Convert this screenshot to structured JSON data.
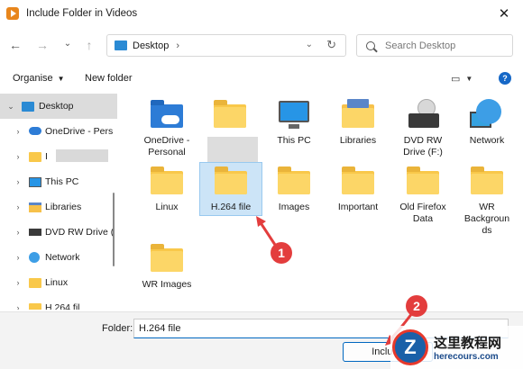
{
  "window": {
    "title": "Include Folder in Videos",
    "close_glyph": "✕"
  },
  "nav": {
    "back": "←",
    "forward": "→",
    "recent": "⌄",
    "up": "↑"
  },
  "address": {
    "location": "Desktop",
    "separator": "›",
    "dropdown": "⌄",
    "refresh": "↻"
  },
  "search": {
    "placeholder": "Search Desktop"
  },
  "toolbar": {
    "organise_label": "Organise",
    "organise_caret": "▼",
    "new_folder_label": "New folder",
    "view_icon": "▭",
    "view_caret": "▼",
    "help_label": "?"
  },
  "sidebar": {
    "items": [
      {
        "chevron": "⌄",
        "label": "Desktop",
        "icon": "desktop-icon",
        "selected": true
      },
      {
        "chevron": "›",
        "label": "OneDrive - Pers",
        "icon": "onedrive-icon"
      },
      {
        "chevron": "›",
        "label": "I",
        "icon": "folder-icon"
      },
      {
        "chevron": "›",
        "label": "This PC",
        "icon": "monitor-icon"
      },
      {
        "chevron": "›",
        "label": "Libraries",
        "icon": "libraries-icon"
      },
      {
        "chevron": "›",
        "label": "DVD RW Drive (",
        "icon": "dvd-icon"
      },
      {
        "chevron": "›",
        "label": "Network",
        "icon": "network-icon"
      },
      {
        "chevron": "›",
        "label": "Linux",
        "icon": "folder-icon"
      },
      {
        "chevron": "›",
        "label": "H.264 fil",
        "icon": "folder-icon"
      }
    ]
  },
  "content": {
    "tiles": [
      {
        "label": "OneDrive -\nPersonal",
        "icon": "onedrive-folder-icon"
      },
      {
        "label": "",
        "icon": "folder-icon"
      },
      {
        "label": "This PC",
        "icon": "monitor-icon"
      },
      {
        "label": "Libraries",
        "icon": "libraries-icon"
      },
      {
        "label": "DVD RW\nDrive (F:)",
        "icon": "dvd-drive-icon"
      },
      {
        "label": "Network",
        "icon": "network-icon"
      },
      {
        "label": "Linux",
        "icon": "folder-icon"
      },
      {
        "label": "H.264 file",
        "icon": "folder-icon",
        "selected": true
      },
      {
        "label": "Images",
        "icon": "folder-icon"
      },
      {
        "label": "Important",
        "icon": "folder-icon"
      },
      {
        "label": "Old Firefox\nData",
        "icon": "folder-icon"
      },
      {
        "label": "WR\nBackgroun\nds",
        "icon": "folder-icon"
      },
      {
        "label": "WR Images",
        "icon": "folder-icon"
      }
    ]
  },
  "footer": {
    "folder_label": "Folder:",
    "folder_value": "H.264 file",
    "include_button": "Include"
  },
  "annotations": {
    "step1": "1",
    "step2": "2"
  },
  "watermark": {
    "logo_letter": "Z",
    "site_name": "这里教程网",
    "site_url": "herecours.com"
  },
  "colors": {
    "accent": "#0067c0",
    "folder": "#fcd667",
    "badge": "#e33d3d",
    "selection": "#cce4f7"
  }
}
